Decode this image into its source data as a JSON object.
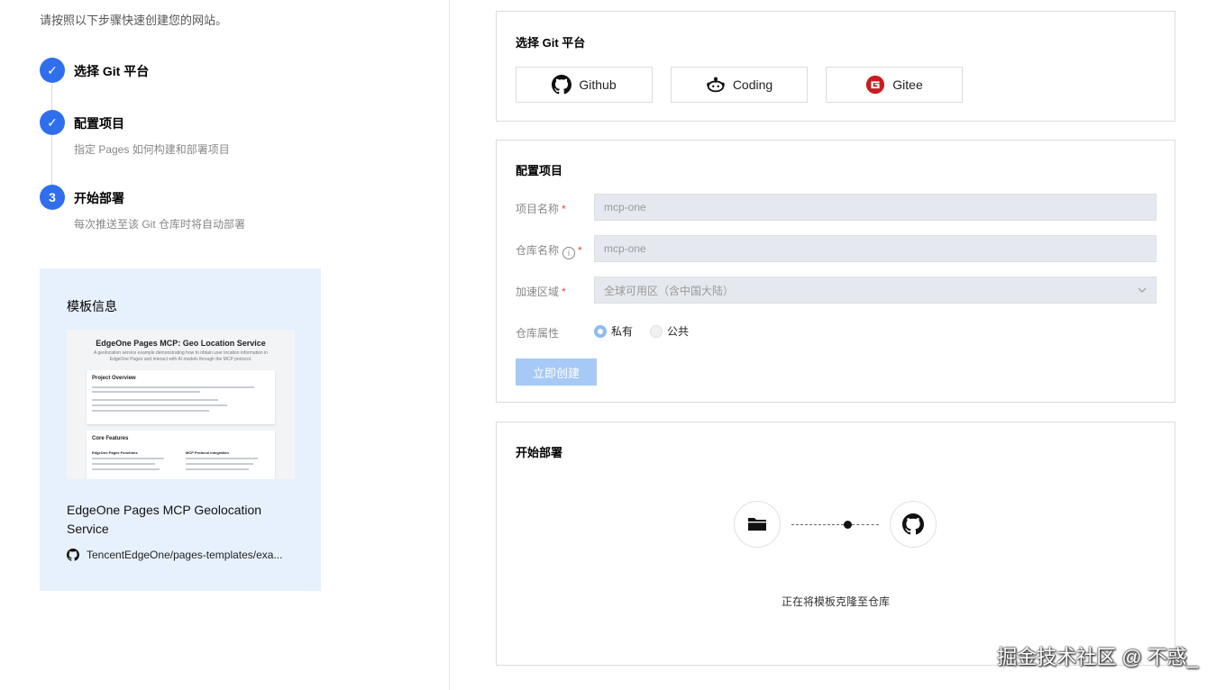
{
  "intro": "请按照以下步骤快速创建您的网站。",
  "steps": [
    {
      "marker": "✓",
      "title": "选择 Git 平台",
      "desc": ""
    },
    {
      "marker": "✓",
      "title": "配置项目",
      "desc": "指定 Pages 如何构建和部署项目"
    },
    {
      "marker": "3",
      "title": "开始部署",
      "desc": "每次推送至该 Git 仓库时将自动部署"
    }
  ],
  "template": {
    "heading": "模板信息",
    "preview": {
      "title": "EdgeOne Pages MCP: Geo Location Service",
      "desc": "A geolocation service example demonstrating how to obtain user location information in EdgeOne Pages and interact with AI models through the MCP protocol.",
      "section1": "Project Overview",
      "section2": "Core Features",
      "col1": "EdgeOne Pages Functions",
      "col2": "MCP Protocol Integration"
    },
    "name": "EdgeOne Pages MCP Geolocation Service",
    "repo": "TencentEdgeOne/pages-templates/exa..."
  },
  "git_platform": {
    "title": "选择 Git 平台",
    "options": [
      {
        "label": "Github",
        "icon": "github-icon"
      },
      {
        "label": "Coding",
        "icon": "coding-icon"
      },
      {
        "label": "Gitee",
        "icon": "gitee-icon"
      }
    ]
  },
  "config": {
    "title": "配置项目",
    "project_name_label": "项目名称",
    "project_name_value": "mcp-one",
    "repo_name_label": "仓库名称",
    "repo_name_value": "mcp-one",
    "region_label": "加速区域",
    "region_value": "全球可用区（含中国大陆）",
    "repo_attr_label": "仓库属性",
    "radio_private": "私有",
    "radio_public": "公共",
    "create_button": "立即创建",
    "required_mark": "*"
  },
  "deploy": {
    "title": "开始部署",
    "status": "正在将模板克隆至仓库"
  },
  "watermark": "掘金技术社区 @ 不惑_",
  "colors": {
    "accent": "#2f6fed",
    "template_bg": "#e7f1fd",
    "button_disabled": "#a7c9f6",
    "required": "#e54545",
    "gitee_red": "#c71d23"
  }
}
